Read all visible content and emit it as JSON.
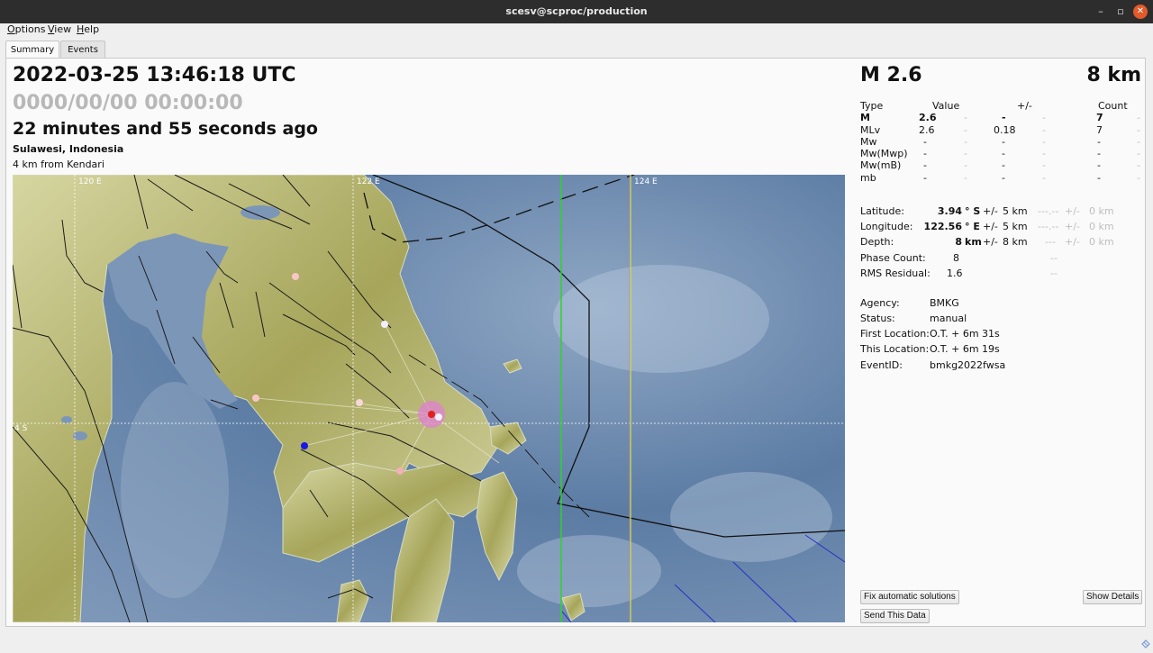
{
  "window": {
    "title": "scesv@scproc/production",
    "controls": {
      "minimize": "–",
      "maximize": "▫",
      "close": "✕"
    }
  },
  "menu": [
    {
      "label": "Options",
      "mnemonic": "O",
      "rest": "ptions"
    },
    {
      "label": "View",
      "mnemonic": "V",
      "rest": "iew"
    },
    {
      "label": "Help",
      "mnemonic": "H",
      "rest": "elp"
    }
  ],
  "tabs": [
    {
      "label": "Summary",
      "active": true
    },
    {
      "label": "Events",
      "active": false
    }
  ],
  "event": {
    "origin_time": "2022-03-25 13:46:18 UTC",
    "local_time": "0000/00/00  00:00:00",
    "elapsed": "22 minutes and 55 seconds ago",
    "region": "Sulawesi, Indonesia",
    "nearest_city": "4 km from Kendari",
    "magnitude_header": "M 2.6",
    "depth_header": "8 km"
  },
  "map": {
    "grid_labels": {
      "lon_120": "120 E",
      "lon_122": "122 E",
      "lon_124": "124 E",
      "lat_4": "4 S"
    },
    "colors": {
      "epicenter": "#e0201e",
      "uncertainty": "#e080d0",
      "station_active": "#f7c7c7",
      "station_white": "#f0f0ff",
      "station_blue": "#1818e8",
      "meridian_green": "#2fd22f",
      "land": "#c9c98f",
      "sea": "#6c89ad"
    }
  },
  "magnitudes": {
    "headers": {
      "type": "Type",
      "value": "Value",
      "uncertainty": "+/-",
      "count": "Count"
    },
    "rows": [
      {
        "type": "M",
        "value": "2.6",
        "uncertainty": "-",
        "count": "7",
        "bold": true
      },
      {
        "type": "MLv",
        "value": "2.6",
        "uncertainty": "0.18",
        "count": "7",
        "bold": false
      },
      {
        "type": "Mw",
        "value": "-",
        "uncertainty": "-",
        "count": "-",
        "bold": false
      },
      {
        "type": "Mw(Mwp)",
        "value": "-",
        "uncertainty": "-",
        "count": "-",
        "bold": false
      },
      {
        "type": "Mw(mB)",
        "value": "-",
        "uncertainty": "-",
        "count": "-",
        "bold": false
      },
      {
        "type": "mb",
        "value": "-",
        "uncertainty": "-",
        "count": "-",
        "bold": false
      }
    ],
    "dash": "-"
  },
  "location": {
    "latitude": {
      "label": "Latitude:",
      "value": "3.94",
      "unit": "° S",
      "pm": "+/-",
      "err": "5 km",
      "ref": "---.--",
      "ref_pm": "+/-",
      "ref_err": "0 km"
    },
    "longitude": {
      "label": "Longitude:",
      "value": "122.56",
      "unit": "° E",
      "pm": "+/-",
      "err": "5 km",
      "ref": "---.--",
      "ref_pm": "+/-",
      "ref_err": "0 km"
    },
    "depth": {
      "label": "Depth:",
      "value": "8",
      "unit": "km",
      "pm": "+/-",
      "err": "8 km",
      "ref": "---",
      "ref_pm": "+/-",
      "ref_err": "0 km"
    },
    "phase_count": {
      "label": "Phase Count:",
      "value": "8",
      "ref": "--"
    },
    "rms_residual": {
      "label": "RMS Residual:",
      "value": "1.6",
      "ref": "--"
    }
  },
  "info": {
    "agency": {
      "label": "Agency:",
      "value": "BMKG"
    },
    "status": {
      "label": "Status:",
      "value": "manual"
    },
    "first_location": {
      "label": "First Location:",
      "value": "O.T. + 6m 31s"
    },
    "this_location": {
      "label": "This Location:",
      "value": "O.T. + 6m 19s"
    },
    "event_id": {
      "label": "EventID:",
      "value": "bmkg2022fwsa"
    }
  },
  "buttons": {
    "fix_automatic": "Fix automatic solutions",
    "show_details": "Show Details",
    "send_data": "Send This Data"
  }
}
